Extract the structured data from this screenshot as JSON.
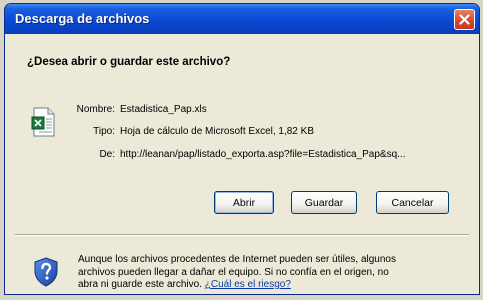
{
  "window": {
    "title": "Descarga de archivos"
  },
  "dialog": {
    "question": "¿Desea abrir o guardar este archivo?",
    "fields": [
      {
        "label": "Nombre:",
        "value": "Estadistica_Pap.xls"
      },
      {
        "label": "Tipo:",
        "value": "Hoja de cálculo de Microsoft Excel, 1,82 KB"
      },
      {
        "label": "De:",
        "value": "http://leanan/pap/listado_exporta.asp?file=Estadistica_Pap&sq..."
      }
    ],
    "buttons": {
      "open": "Abrir",
      "save": "Guardar",
      "cancel": "Cancelar"
    },
    "warning": {
      "text": "Aunque los archivos procedentes de Internet pueden ser útiles, algunos archivos pueden llegar a dañar el equipo. Si no confía en el origen, no abra ni guarde este archivo.",
      "link": "¿Cuál es el riesgo?"
    }
  },
  "colors": {
    "titlebar": "#0a49d4",
    "dialog_bg": "#ece9d8",
    "close": "#d6462b",
    "link": "#0b3aa8"
  },
  "icons": {
    "file": "excel-file-icon",
    "warning": "shield-question-icon",
    "close": "close-icon"
  }
}
